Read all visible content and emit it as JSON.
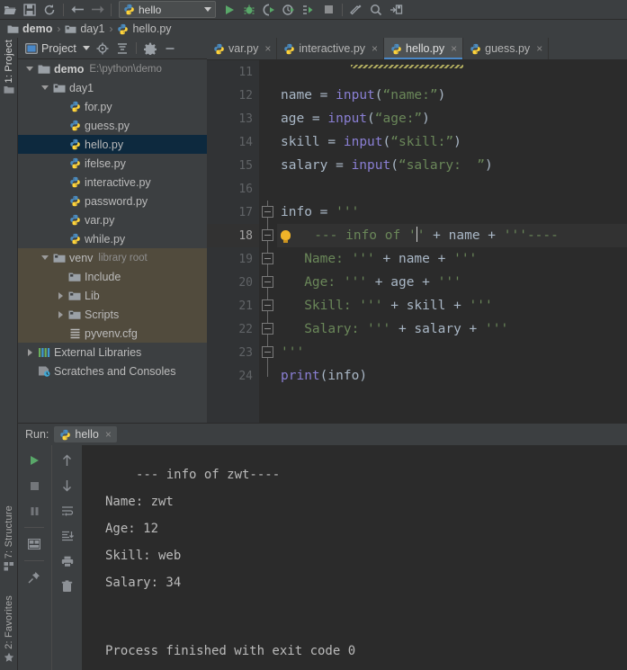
{
  "toolbar": {
    "icons": [
      {
        "name": "open-folder-icon",
        "glyph": "open"
      },
      {
        "name": "save-all-icon",
        "glyph": "save"
      },
      {
        "name": "sync-icon",
        "glyph": "sync"
      },
      {
        "name": "undo-icon",
        "glyph": "undo"
      },
      {
        "name": "redo-icon",
        "glyph": "redo"
      }
    ],
    "run_config": {
      "label": "hello",
      "icon": "python-file-icon"
    },
    "run_icons": [
      {
        "name": "run-button",
        "glyph": "run"
      },
      {
        "name": "debug-button",
        "glyph": "debug"
      },
      {
        "name": "run-with-coverage-button",
        "glyph": "coverage"
      },
      {
        "name": "profile-button",
        "glyph": "profile"
      },
      {
        "name": "run-more-button",
        "glyph": "runmore"
      },
      {
        "name": "stop-button",
        "glyph": "stop"
      }
    ],
    "right_icons": [
      {
        "name": "build-icon",
        "glyph": "hammer"
      },
      {
        "name": "search-everywhere-icon",
        "glyph": "search"
      },
      {
        "name": "settings-sync-icon",
        "glyph": "updates"
      }
    ]
  },
  "breadcrumb": {
    "items": [
      {
        "label": "demo",
        "icon": "folder-icon",
        "bold": true
      },
      {
        "label": "day1",
        "icon": "folder-module-icon",
        "bold": false
      },
      {
        "label": "hello.py",
        "icon": "python-file-icon",
        "bold": false
      }
    ],
    "separator": "›"
  },
  "left_stripe": {
    "top": {
      "label": "1: Project",
      "icon": "project-folder-icon",
      "active": true
    },
    "bottom": [
      {
        "label": "7: Structure",
        "icon": "structure-icon"
      },
      {
        "label": "2: Favorites",
        "icon": "star-icon"
      }
    ]
  },
  "project_panel": {
    "title": "Project",
    "toolbar_icons": [
      {
        "name": "select-opened-file-icon",
        "glyph": "target"
      },
      {
        "name": "collapse-all-icon",
        "glyph": "collapse"
      },
      {
        "name": "settings-gear-icon",
        "glyph": "gear"
      },
      {
        "name": "hide-panel-icon",
        "glyph": "minus"
      }
    ],
    "tree": [
      {
        "label": "demo",
        "note": "E:\\python\\demo",
        "icon": "folder-icon",
        "indent": 0,
        "arrow": "down",
        "bold": true,
        "state": "normal"
      },
      {
        "label": "day1",
        "note": "",
        "icon": "folder-module-icon",
        "indent": 1,
        "arrow": "down",
        "bold": false,
        "state": "normal"
      },
      {
        "label": "for.py",
        "note": "",
        "icon": "python-file-icon",
        "indent": 2,
        "arrow": "none",
        "bold": false,
        "state": "normal"
      },
      {
        "label": "guess.py",
        "note": "",
        "icon": "python-file-icon",
        "indent": 2,
        "arrow": "none",
        "bold": false,
        "state": "normal"
      },
      {
        "label": "hello.py",
        "note": "",
        "icon": "python-file-icon",
        "indent": 2,
        "arrow": "none",
        "bold": false,
        "state": "selected"
      },
      {
        "label": "ifelse.py",
        "note": "",
        "icon": "python-file-icon",
        "indent": 2,
        "arrow": "none",
        "bold": false,
        "state": "normal"
      },
      {
        "label": "interactive.py",
        "note": "",
        "icon": "python-file-icon",
        "indent": 2,
        "arrow": "none",
        "bold": false,
        "state": "normal"
      },
      {
        "label": "password.py",
        "note": "",
        "icon": "python-file-icon",
        "indent": 2,
        "arrow": "none",
        "bold": false,
        "state": "normal"
      },
      {
        "label": "var.py",
        "note": "",
        "icon": "python-file-icon",
        "indent": 2,
        "arrow": "none",
        "bold": false,
        "state": "normal"
      },
      {
        "label": "while.py",
        "note": "",
        "icon": "python-file-icon",
        "indent": 2,
        "arrow": "none",
        "bold": false,
        "state": "normal"
      },
      {
        "label": "venv",
        "note": "library root",
        "icon": "folder-module-icon",
        "indent": 1,
        "arrow": "down",
        "bold": false,
        "state": "venv"
      },
      {
        "label": "Include",
        "note": "",
        "icon": "folder-module-icon",
        "indent": 2,
        "arrow": "none",
        "bold": false,
        "state": "venv"
      },
      {
        "label": "Lib",
        "note": "",
        "icon": "folder-module-icon",
        "indent": 2,
        "arrow": "right",
        "bold": false,
        "state": "venv"
      },
      {
        "label": "Scripts",
        "note": "",
        "icon": "folder-module-icon",
        "indent": 2,
        "arrow": "right",
        "bold": false,
        "state": "venv"
      },
      {
        "label": "pyvenv.cfg",
        "note": "",
        "icon": "config-file-icon",
        "indent": 2,
        "arrow": "none",
        "bold": false,
        "state": "venv"
      },
      {
        "label": "External Libraries",
        "note": "",
        "icon": "libraries-icon",
        "indent": 0,
        "arrow": "right",
        "bold": false,
        "state": "normal"
      },
      {
        "label": "Scratches and Consoles",
        "note": "",
        "icon": "scratches-icon",
        "indent": 0,
        "arrow": "none",
        "bold": false,
        "state": "normal"
      }
    ]
  },
  "editor": {
    "tabs": [
      {
        "label": "var.py",
        "icon": "python-file-icon",
        "active": false
      },
      {
        "label": "interactive.py",
        "icon": "python-file-icon",
        "active": false
      },
      {
        "label": "hello.py",
        "icon": "python-file-icon",
        "active": true
      },
      {
        "label": "guess.py",
        "icon": "python-file-icon",
        "active": false
      }
    ],
    "close_glyph": "×",
    "line_numbers": [
      "11",
      "12",
      "13",
      "14",
      "15",
      "16",
      "17",
      "18",
      "19",
      "20",
      "21",
      "22",
      "23",
      "24"
    ],
    "current_line": "18",
    "lines": [
      {
        "n": "11",
        "tokens": []
      },
      {
        "n": "12",
        "tokens": [
          {
            "t": "name ",
            "c": "k-var"
          },
          {
            "t": "= ",
            "c": "k-op"
          },
          {
            "t": "input",
            "c": "k-fn"
          },
          {
            "t": "(",
            "c": "k-punct"
          },
          {
            "t": "“name:”",
            "c": "k-str"
          },
          {
            "t": ")",
            "c": "k-punct"
          }
        ]
      },
      {
        "n": "13",
        "tokens": [
          {
            "t": "age ",
            "c": "k-var"
          },
          {
            "t": "= ",
            "c": "k-op"
          },
          {
            "t": "input",
            "c": "k-fn"
          },
          {
            "t": "(",
            "c": "k-punct"
          },
          {
            "t": "“age:”",
            "c": "k-str"
          },
          {
            "t": ")",
            "c": "k-punct"
          }
        ]
      },
      {
        "n": "14",
        "tokens": [
          {
            "t": "skill ",
            "c": "k-var"
          },
          {
            "t": "= ",
            "c": "k-op"
          },
          {
            "t": "input",
            "c": "k-fn"
          },
          {
            "t": "(",
            "c": "k-punct"
          },
          {
            "t": "“skill:”",
            "c": "k-str"
          },
          {
            "t": ")",
            "c": "k-punct"
          }
        ]
      },
      {
        "n": "15",
        "tokens": [
          {
            "t": "salary ",
            "c": "k-var"
          },
          {
            "t": "= ",
            "c": "k-op"
          },
          {
            "t": "input",
            "c": "k-fn"
          },
          {
            "t": "(",
            "c": "k-punct"
          },
          {
            "t": "“salary:  ”",
            "c": "k-str"
          },
          {
            "t": ")",
            "c": "k-punct"
          }
        ]
      },
      {
        "n": "16",
        "tokens": []
      },
      {
        "n": "17",
        "tokens": [
          {
            "t": "info ",
            "c": "k-var"
          },
          {
            "t": "= ",
            "c": "k-op"
          },
          {
            "t": "'''",
            "c": "k-str"
          }
        ]
      },
      {
        "n": "18",
        "tokens": [
          {
            "t": "   --- info of '",
            "c": "k-str"
          },
          {
            "t": "|CARET|",
            "c": "caret"
          },
          {
            "t": "' ",
            "c": "k-str"
          },
          {
            "t": "+ ",
            "c": "k-op"
          },
          {
            "t": "name ",
            "c": "k-var"
          },
          {
            "t": "+ ",
            "c": "k-op"
          },
          {
            "t": "'''----",
            "c": "k-str"
          }
        ]
      },
      {
        "n": "19",
        "tokens": [
          {
            "t": "   Name: ''' ",
            "c": "k-str"
          },
          {
            "t": "+ ",
            "c": "k-op"
          },
          {
            "t": "name ",
            "c": "k-var"
          },
          {
            "t": "+ ",
            "c": "k-op"
          },
          {
            "t": "'''",
            "c": "k-str"
          }
        ]
      },
      {
        "n": "20",
        "tokens": [
          {
            "t": "   Age: ''' ",
            "c": "k-str"
          },
          {
            "t": "+ ",
            "c": "k-op"
          },
          {
            "t": "age ",
            "c": "k-var"
          },
          {
            "t": "+ ",
            "c": "k-op"
          },
          {
            "t": "'''",
            "c": "k-str"
          }
        ]
      },
      {
        "n": "21",
        "tokens": [
          {
            "t": "   Skill: ''' ",
            "c": "k-str"
          },
          {
            "t": "+ ",
            "c": "k-op"
          },
          {
            "t": "skill ",
            "c": "k-var"
          },
          {
            "t": "+ ",
            "c": "k-op"
          },
          {
            "t": "'''",
            "c": "k-str"
          }
        ]
      },
      {
        "n": "22",
        "tokens": [
          {
            "t": "   Salary: ''' ",
            "c": "k-str"
          },
          {
            "t": "+ ",
            "c": "k-op"
          },
          {
            "t": "salary ",
            "c": "k-var"
          },
          {
            "t": "+ ",
            "c": "k-op"
          },
          {
            "t": "'''",
            "c": "k-str"
          }
        ]
      },
      {
        "n": "23",
        "tokens": [
          {
            "t": "'''",
            "c": "k-str"
          }
        ]
      },
      {
        "n": "24",
        "tokens": [
          {
            "t": "print",
            "c": "k-fn"
          },
          {
            "t": "(",
            "c": "k-punct"
          },
          {
            "t": "info",
            "c": "k-var"
          },
          {
            "t": ")",
            "c": "k-punct"
          }
        ]
      }
    ],
    "intention_bulb": {
      "name": "intention-bulb-icon",
      "line": "18"
    }
  },
  "run_panel": {
    "label": "Run:",
    "tab": {
      "label": "hello",
      "icon": "python-file-icon",
      "close": "×"
    },
    "toolbar_left": [
      {
        "name": "rerun-button",
        "glyph": "run"
      },
      {
        "name": "stop-button",
        "glyph": "stop"
      },
      {
        "name": "pause-output-button",
        "glyph": "pause"
      },
      {
        "name": "layout-settings-button",
        "glyph": "layout"
      },
      {
        "name": "pin-tab-button",
        "glyph": "pin"
      }
    ],
    "toolbar_right": [
      {
        "name": "up-the-stack-trace-button",
        "glyph": "arrow-up"
      },
      {
        "name": "down-the-stack-trace-button",
        "glyph": "arrow-down"
      },
      {
        "name": "soft-wrap-button",
        "glyph": "wrap"
      },
      {
        "name": "scroll-to-end-button",
        "glyph": "scroll-end"
      },
      {
        "name": "print-button",
        "glyph": "print"
      },
      {
        "name": "clear-all-button",
        "glyph": "trash"
      }
    ],
    "console_lines": [
      {
        "text": "--- info of zwt----",
        "indent": true
      },
      {
        "text": "Name: zwt",
        "indent": false
      },
      {
        "text": "Age: 12",
        "indent": false
      },
      {
        "text": "Skill: web",
        "indent": false
      },
      {
        "text": "Salary: 34",
        "indent": false
      },
      {
        "text": "",
        "indent": false
      },
      {
        "text": "Process finished with exit code 0",
        "indent": false
      }
    ]
  },
  "colors": {
    "panel_bg": "#3c3f41",
    "editor_bg": "#2b2b2b",
    "selection_blue": "#0d293e",
    "venv_olive": "#514b3d",
    "tab_accent": "#4a88c7",
    "string_green": "#6a8759",
    "function_purple": "#8a7fd4",
    "variable_gray": "#a9b7c6",
    "run_green": "#59a869"
  }
}
